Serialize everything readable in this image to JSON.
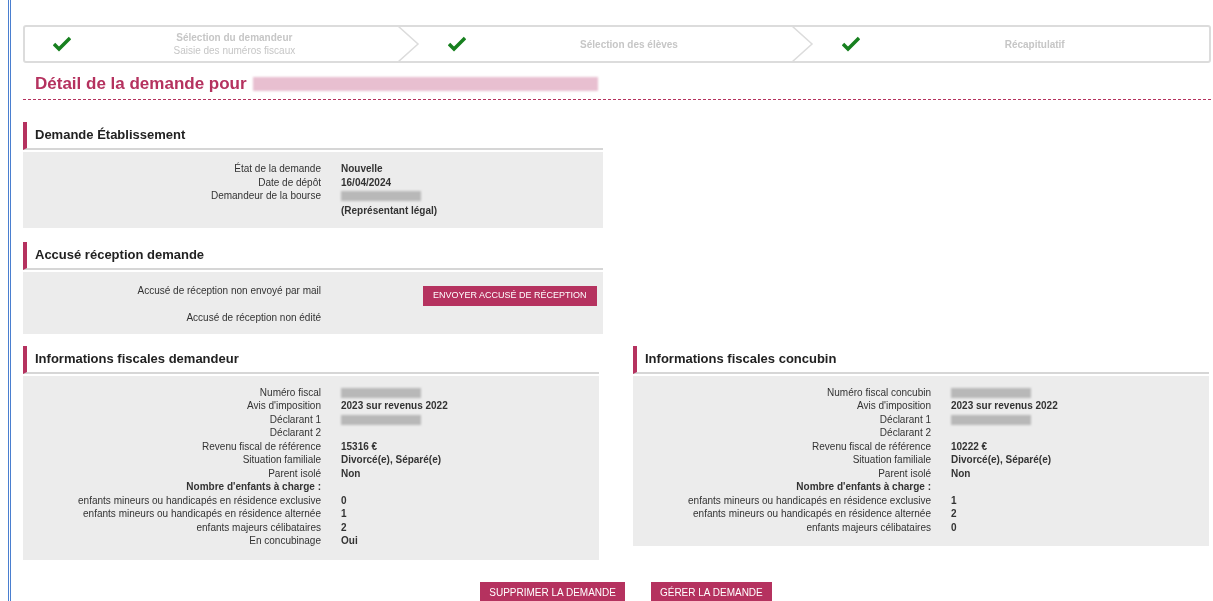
{
  "steps": [
    {
      "title": "Sélection du demandeur",
      "subtitle": "Saisie des numéros fiscaux",
      "done": true
    },
    {
      "title": "Sélection des élèves",
      "done": true
    },
    {
      "title": "Récapitulatif",
      "done": true
    }
  ],
  "heading": {
    "text": "Détail de la demande pour",
    "name_redacted": true
  },
  "sections": [
    {
      "title": "Demande Établissement",
      "kind": "rows",
      "rows": [
        {
          "label": "État de la demande",
          "value": "Nouvelle",
          "kind": "text"
        },
        {
          "label": "Date de dépôt",
          "value": "16/04/2024",
          "kind": "text"
        },
        {
          "label": "Demandeur de la bourse",
          "kind": "redacted",
          "note": "(Représentant légal)"
        }
      ]
    },
    {
      "title": "Accusé réception demande",
      "kind": "receipt",
      "rows": [
        {
          "label": "Accusé de réception non envoyé par mail"
        },
        {
          "label": "Accusé de réception non édité"
        }
      ],
      "button": "ENVOYER ACCUSÉ DE RÉCEPTION"
    }
  ],
  "fiscal": [
    {
      "title": "Informations fiscales demandeur",
      "rows": [
        {
          "label": "Numéro fiscal",
          "kind": "redacted"
        },
        {
          "label": "Avis d'imposition",
          "value": "2023 sur revenus 2022",
          "kind": "text"
        },
        {
          "label": "Déclarant 1",
          "kind": "redacted"
        },
        {
          "label": "Déclarant 2",
          "kind": "text"
        },
        {
          "label": "Revenu fiscal de référence",
          "value": "15316 €",
          "kind": "text"
        },
        {
          "label": "Situation familiale",
          "value": "Divorcé(e), Séparé(e)",
          "kind": "text"
        },
        {
          "label": "Parent isolé",
          "value": "Non",
          "kind": "text"
        },
        {
          "label": "Nombre d'enfants à charge :",
          "kind": "heading"
        },
        {
          "label": "enfants mineurs ou handicapés en résidence exclusive",
          "value": "0",
          "kind": "text"
        },
        {
          "label": "enfants mineurs ou handicapés en résidence alternée",
          "value": "1",
          "kind": "text"
        },
        {
          "label": "enfants majeurs célibataires",
          "value": "2",
          "kind": "text"
        },
        {
          "label": "En concubinage",
          "value": "Oui",
          "kind": "text"
        }
      ]
    },
    {
      "title": "Informations fiscales concubin",
      "rows": [
        {
          "label": "Numéro fiscal concubin",
          "kind": "redacted"
        },
        {
          "label": "Avis d'imposition",
          "value": "2023 sur revenus 2022",
          "kind": "text"
        },
        {
          "label": "Déclarant 1",
          "kind": "redacted"
        },
        {
          "label": "Déclarant 2",
          "kind": "text"
        },
        {
          "label": "Revenu fiscal de référence",
          "value": "10222 €",
          "kind": "text"
        },
        {
          "label": "Situation familiale",
          "value": "Divorcé(e), Séparé(e)",
          "kind": "text"
        },
        {
          "label": "Parent isolé",
          "value": "Non",
          "kind": "text"
        },
        {
          "label": "Nombre d'enfants à charge :",
          "kind": "heading"
        },
        {
          "label": "enfants mineurs ou handicapés en résidence exclusive",
          "value": "1",
          "kind": "text"
        },
        {
          "label": "enfants mineurs ou handicapés en résidence alternée",
          "value": "2",
          "kind": "text"
        },
        {
          "label": "enfants majeurs célibataires",
          "value": "0",
          "kind": "text"
        }
      ]
    }
  ],
  "actions": [
    "SUPPRIMER LA DEMANDE",
    "GÉRER LA DEMANDE"
  ]
}
